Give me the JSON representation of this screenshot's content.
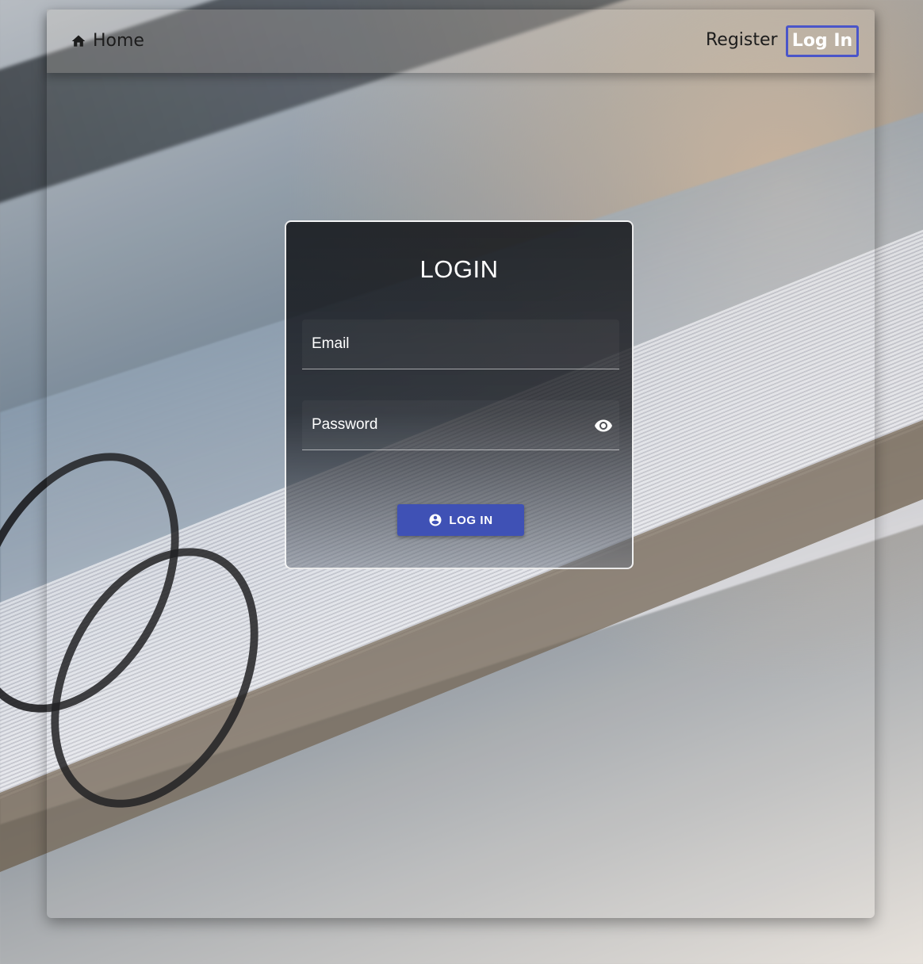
{
  "navbar": {
    "home_label": "Home",
    "home_icon": "home-icon",
    "register_label": "Register",
    "login_label": "Log In"
  },
  "login_card": {
    "title": "LOGIN",
    "email": {
      "placeholder": "Email",
      "value": ""
    },
    "password": {
      "placeholder": "Password",
      "value": "",
      "visibility_icon": "eye-icon"
    },
    "submit": {
      "label": "LOG IN",
      "icon": "account-circle-icon"
    }
  },
  "colors": {
    "primary": "#3f51b5",
    "nav_active_border": "#4a55c9",
    "card_border": "#ffffff"
  }
}
